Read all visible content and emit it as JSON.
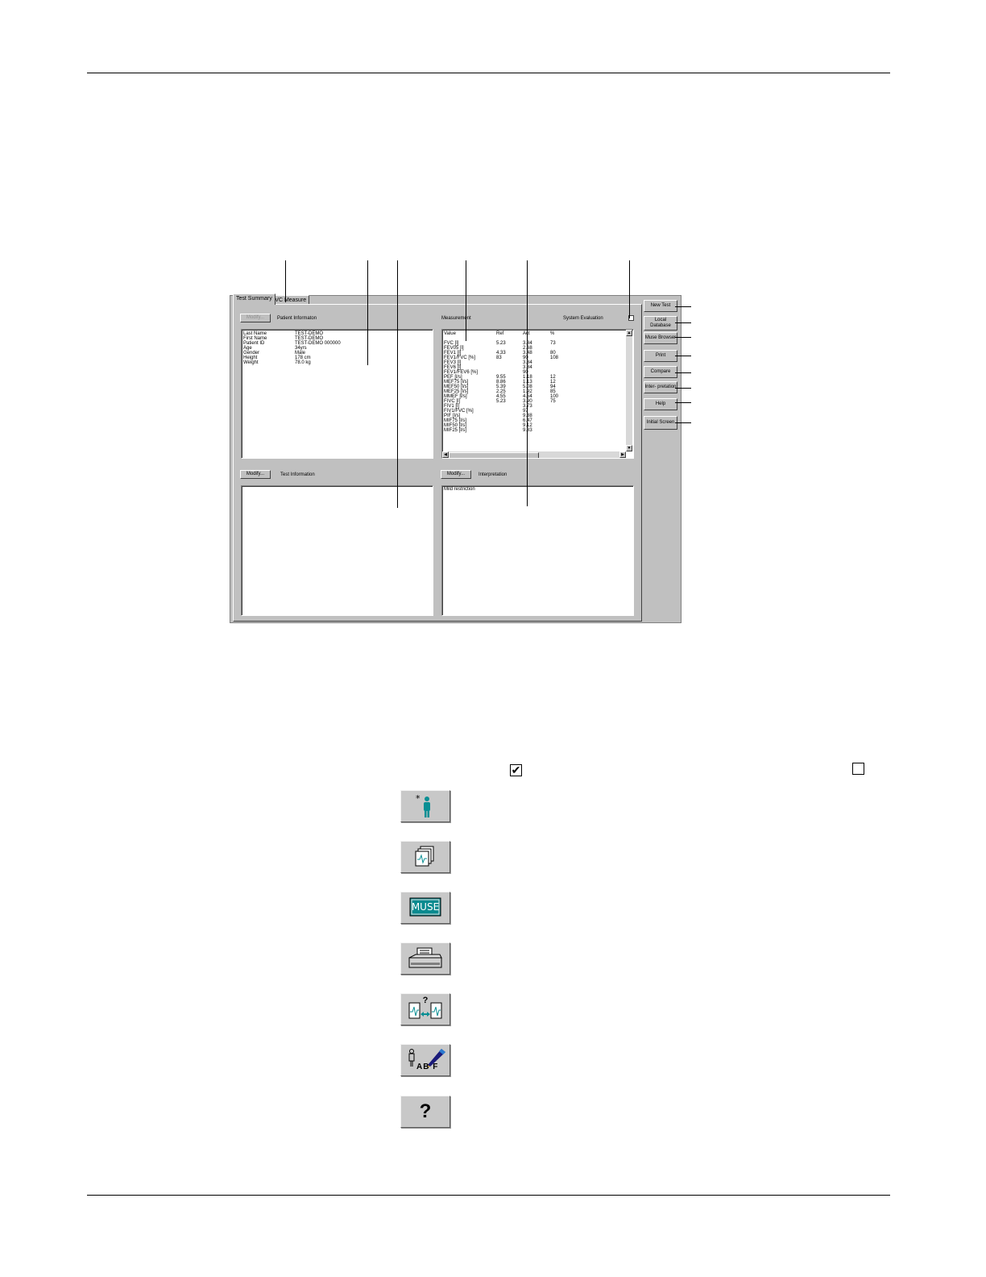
{
  "screen": {
    "tabs": [
      "Test Summary",
      "FVC Measure"
    ],
    "patient_section": {
      "modify_label": "Modify...",
      "title": "Patient Informaton",
      "rows": [
        [
          "Last Name",
          "TEST-DEMO"
        ],
        [
          "First Name",
          "TEST-DEMO"
        ],
        [
          "Patient ID",
          "TEST-DEMO 000000"
        ],
        [
          "Age",
          "34yrs"
        ],
        [
          "Gender",
          "Male"
        ],
        [
          "Height",
          "178 cm"
        ],
        [
          "Weight",
          "78.0 kg"
        ]
      ]
    },
    "measurement_section": {
      "title": "Measurement",
      "system_eval_label": "System Evaluation",
      "headers": [
        "Value",
        "Ref",
        "Act",
        "%"
      ],
      "rows": [
        [
          "",
          "",
          "",
          ""
        ],
        [
          "FVC [l]",
          "5.23",
          "3.84",
          "73"
        ],
        [
          "FEV05 [l]",
          "",
          "2.68",
          ""
        ],
        [
          "FEV1 [l]",
          "4.33",
          "3.48",
          "80"
        ],
        [
          "FEV1/FVC [%]",
          "83",
          "90",
          "108"
        ],
        [
          "FEV3 [l]",
          "",
          "3.84",
          ""
        ],
        [
          "FEV6 [l]",
          "",
          "3.84",
          ""
        ],
        [
          "FEV1/FEV6 [%]",
          "",
          "90",
          ""
        ],
        [
          "PEF [l/s]",
          "9.55",
          "1.18",
          "12"
        ],
        [
          "MEF75 [l/s]",
          "8.86",
          "1.13",
          "12"
        ],
        [
          "MEF50 [l/s]",
          "5.39",
          "5.08",
          "94"
        ],
        [
          "MEF25 [l/s]",
          "2.25",
          "1.92",
          "85"
        ],
        [
          "MMEF [l/s]",
          "4.55",
          "4.54",
          "100"
        ],
        [
          "FIVC [l]",
          "5.23",
          "3.90",
          "75"
        ],
        [
          "FIV1 [l]",
          "",
          "3.73",
          ""
        ],
        [
          "FIV1/FVC [%]",
          "",
          "97",
          ""
        ],
        [
          "PIF [l/s]",
          "",
          "9.88",
          ""
        ],
        [
          "MIF75 [l/s]",
          "",
          "6.47",
          ""
        ],
        [
          "MIF50 [l/s]",
          "",
          "9.12",
          ""
        ],
        [
          "MIF25 [l/s]",
          "",
          "9.83",
          ""
        ]
      ]
    },
    "test_info_section": {
      "modify_label": "Modify...",
      "title": "Test Information"
    },
    "interpretation_section": {
      "modify_label": "Modify...",
      "title": "Interpretation",
      "text": "Mild restriction"
    },
    "side_buttons": [
      "New Test",
      "Local Database",
      "Muse Browser",
      "Print",
      "Compare",
      "Inter- pretation",
      "Help",
      "Initial Screen"
    ]
  },
  "legend": {
    "checked_symbol": "✔",
    "unchecked_symbol": "",
    "icons": [
      {
        "icon": "new-test-person-icon"
      },
      {
        "icon": "local-database-icon"
      },
      {
        "icon": "muse-icon",
        "text": "MUSE"
      },
      {
        "icon": "printer-icon"
      },
      {
        "icon": "compare-icon",
        "text": "?"
      },
      {
        "icon": "interpretation-icon",
        "text": "AB F"
      },
      {
        "icon": "help-icon",
        "text": "?"
      }
    ]
  },
  "colors": {
    "window_gray": "#c0c0c0",
    "teal": "#0a8f94",
    "muse_bg": "#0a8a8f"
  }
}
